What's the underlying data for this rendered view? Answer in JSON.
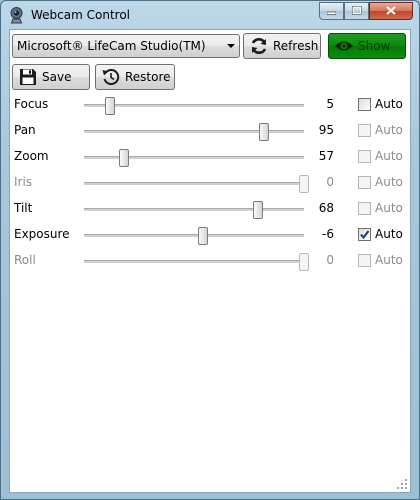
{
  "window": {
    "title": "Webcam Control"
  },
  "toolbar": {
    "device_selected": "Microsoft® LifeCam Studio(TM)",
    "refresh_label": "Refresh",
    "show_label": "Show",
    "save_label": "Save",
    "restore_label": "Restore"
  },
  "auto_label": "Auto",
  "properties": [
    {
      "name": "Focus",
      "value": "5",
      "slider_fraction": 0.12,
      "enabled": true,
      "auto_checked": false,
      "auto_enabled": true
    },
    {
      "name": "Pan",
      "value": "95",
      "slider_fraction": 0.82,
      "enabled": true,
      "auto_checked": false,
      "auto_enabled": false
    },
    {
      "name": "Zoom",
      "value": "57",
      "slider_fraction": 0.18,
      "enabled": true,
      "auto_checked": false,
      "auto_enabled": false
    },
    {
      "name": "Iris",
      "value": "0",
      "slider_fraction": 1.0,
      "enabled": false,
      "auto_checked": false,
      "auto_enabled": false
    },
    {
      "name": "Tilt",
      "value": "68",
      "slider_fraction": 0.79,
      "enabled": true,
      "auto_checked": false,
      "auto_enabled": false
    },
    {
      "name": "Exposure",
      "value": "-6",
      "slider_fraction": 0.54,
      "enabled": true,
      "auto_checked": true,
      "auto_enabled": true
    },
    {
      "name": "Roll",
      "value": "0",
      "slider_fraction": 1.0,
      "enabled": false,
      "auto_checked": false,
      "auto_enabled": false
    }
  ],
  "icons": {
    "app": "webcam-icon",
    "refresh": "refresh-icon",
    "show": "eye-icon",
    "save": "floppy-disk-icon",
    "restore": "restore-icon"
  },
  "colors": {
    "show_button": "#0c8a0c",
    "accent_refresh": "#1b1b1b"
  }
}
